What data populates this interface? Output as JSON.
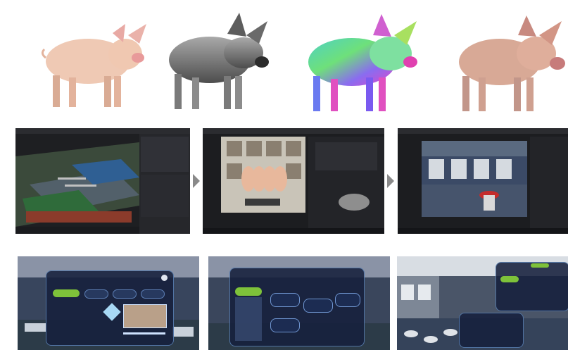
{
  "figure": {
    "rows": [
      {
        "id": "model-renderings",
        "panels": [
          "pig-photo",
          "pig-grey-mesh",
          "pig-normal-map",
          "pig-textured"
        ]
      },
      {
        "id": "engine-workflow",
        "panels": [
          "farm-scene-editor",
          "texture-editor",
          "barn-interior-editor"
        ]
      },
      {
        "id": "vr-interface",
        "panels": [
          "vr-menu-main",
          "vr-menu-detail",
          "vr-menu-in-barn"
        ]
      }
    ],
    "colors": {
      "pig_skin": "#e9c1a8",
      "mesh_grey": "#7e7e7e",
      "editor_dark": "#1e1f22",
      "vr_ui_panel": "#16203c",
      "vr_ui_accent": "#7ec23a"
    }
  },
  "icons": {
    "arrow": "chevron-right-arrow-icon",
    "cube": "ice-cube-icon"
  }
}
